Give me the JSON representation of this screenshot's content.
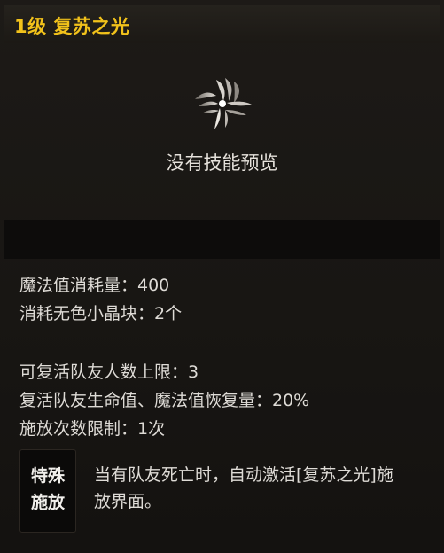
{
  "header": {
    "skill_title": "1级 复苏之光"
  },
  "preview": {
    "icon": "feather-wing-icon",
    "no_preview_text": "没有技能预览"
  },
  "stats": {
    "lines": [
      "魔法值消耗量：400",
      "消耗无色小晶块：2个",
      "可复活队友人数上限：3",
      "复活队友生命值、魔法值恢复量：20%",
      "施放次数限制：1次"
    ]
  },
  "special": {
    "badge_line1": "特殊",
    "badge_line2": "施放",
    "description": "当有队友死亡时，自动激活[复苏之光]施放界面。"
  },
  "colors": {
    "title": "#f2c21b",
    "text": "#dedbd6",
    "background": "#1a1714"
  }
}
